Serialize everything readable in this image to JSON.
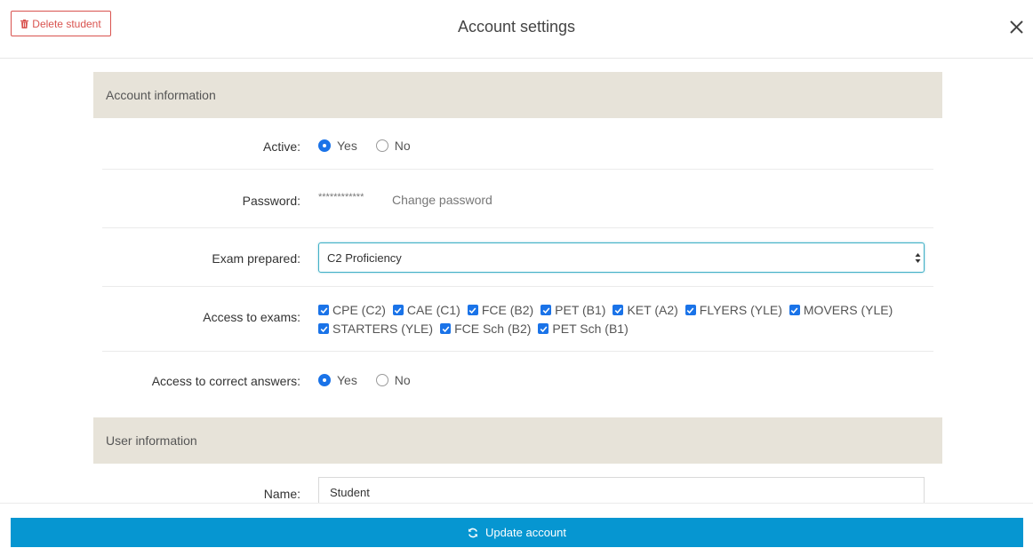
{
  "header": {
    "delete_label": "Delete student",
    "title": "Account settings"
  },
  "account_section": {
    "title": "Account information",
    "active": {
      "label": "Active:",
      "yes": "Yes",
      "no": "No",
      "selected": "Yes"
    },
    "password": {
      "label": "Password:",
      "masked": "************",
      "change_link": "Change password"
    },
    "exam": {
      "label": "Exam prepared:",
      "value": "C2 Proficiency"
    },
    "access_exams": {
      "label": "Access to exams:",
      "options": [
        "CPE (C2)",
        "CAE (C1)",
        "FCE (B2)",
        "PET (B1)",
        "KET (A2)",
        "FLYERS (YLE)",
        "MOVERS (YLE)",
        "STARTERS (YLE)",
        "FCE Sch (B2)",
        "PET Sch (B1)"
      ]
    },
    "correct_answers": {
      "label": "Access to correct answers:",
      "yes": "Yes",
      "no": "No",
      "selected": "Yes"
    }
  },
  "user_section": {
    "title": "User information",
    "name": {
      "label": "Name:",
      "value": "Student"
    }
  },
  "footer": {
    "update_label": "Update account"
  },
  "colors": {
    "accent": "#0696d1",
    "danger": "#d9534f",
    "section_bg": "#e7e3d9",
    "checkbox": "#1a73e8"
  }
}
